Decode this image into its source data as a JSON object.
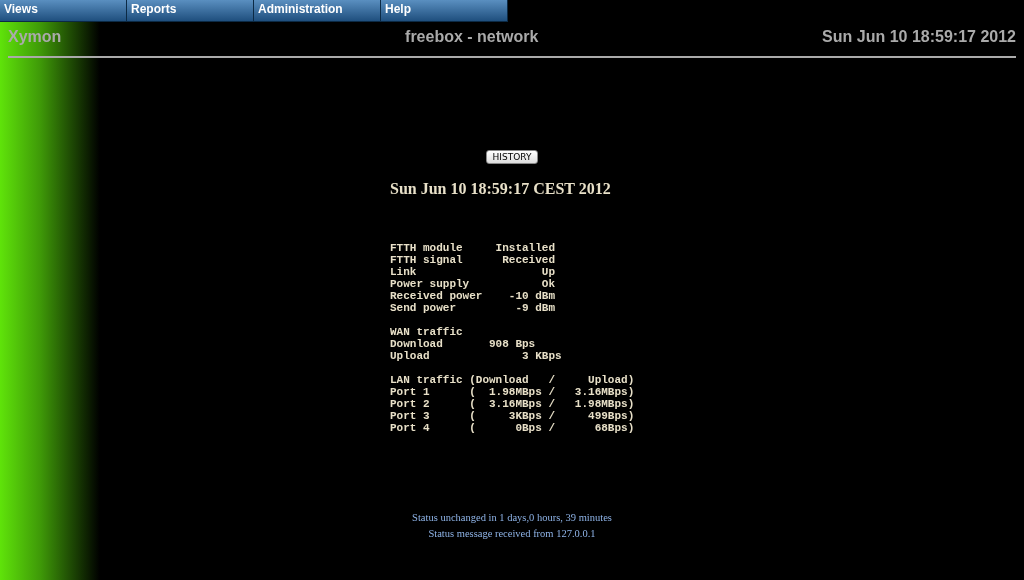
{
  "menu": [
    "Views",
    "Reports",
    "Administration",
    "Help"
  ],
  "header": {
    "brand": "Xymon",
    "title": "freebox - network",
    "datetime": "Sun Jun 10 18:59:17 2012"
  },
  "history_button": "HISTORY",
  "report_time": "Sun Jun 10 18:59:17 CEST 2012",
  "status_groups": [
    [
      "FTTH module     Installed",
      "FTTH signal      Received",
      "Link                   Up",
      "Power supply           Ok",
      "Received power    -10 dBm",
      "Send power         -9 dBm"
    ],
    [
      "WAN traffic",
      "Download       908 Bps",
      "Upload              3 KBps"
    ],
    [
      "LAN traffic (Download   /     Upload)",
      "Port 1      (  1.98MBps /   3.16MBps)",
      "Port 2      (  3.16MBps /   1.98MBps)",
      "Port 3      (     3KBps /     499Bps)",
      "Port 4      (      0Bps /      68Bps)"
    ]
  ],
  "footer": [
    "Status unchanged in 1 days,0 hours, 39 minutes",
    "Status message received from 127.0.0.1"
  ]
}
